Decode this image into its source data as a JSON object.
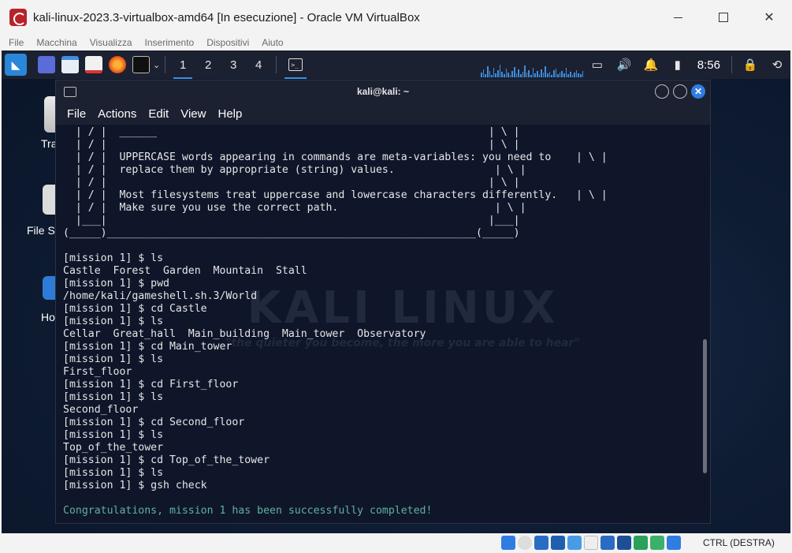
{
  "window": {
    "title": "kali-linux-2023.3-virtualbox-amd64 [In esecuzione] - Oracle VM VirtualBox",
    "minimize": "",
    "maximize": "",
    "close": "✕"
  },
  "vbox_menu": [
    "File",
    "Macchina",
    "Visualizza",
    "Inserimento",
    "Dispositivi",
    "Aiuto"
  ],
  "panel": {
    "workspaces": [
      "1",
      "2",
      "3",
      "4"
    ],
    "clock": "8:56"
  },
  "desktop": {
    "icons": [
      {
        "label": "Tras"
      },
      {
        "label": "File S"
      },
      {
        "label": "Ho"
      }
    ]
  },
  "terminal": {
    "title": "kali@kali: ~",
    "menu": [
      "File",
      "Actions",
      "Edit",
      "View",
      "Help"
    ],
    "watermark": {
      "main": "KALI LINUX",
      "sub": "\"the quieter you become, the more you are able to hear\""
    },
    "lines": [
      "  | / |  ______                                                     | \\ |",
      "  | / |                                                             | \\ |",
      "  | / |  UPPERCASE words appearing in commands are meta-variables: you need to    | \\ |",
      "  | / |  replace them by appropriate (string) values.                | \\ |",
      "  | / |                                                             | \\ |",
      "  | / |  Most filesystems treat uppercase and lowercase characters differently.   | \\ |",
      "  | / |  Make sure you use the correct path.                         | \\ |",
      "  |___|                                                             |___|",
      "(_____)___________________________________________________________(_____)",
      "",
      "[mission 1] $ ls",
      "Castle  Forest  Garden  Mountain  Stall",
      "[mission 1] $ pwd",
      "/home/kali/gameshell.sh.3/World",
      "[mission 1] $ cd Castle",
      "[mission 1] $ ls",
      "Cellar  Great_hall  Main_building  Main_tower  Observatory",
      "[mission 1] $ cd Main_tower",
      "[mission 1] $ ls",
      "First_floor",
      "[mission 1] $ cd First_floor",
      "[mission 1] $ ls",
      "Second_floor",
      "[mission 1] $ cd Second_floor",
      "[mission 1] $ ls",
      "Top_of_the_tower",
      "[mission 1] $ cd Top_of_the_tower",
      "[mission 1] $ ls",
      "[mission 1] $ gsh check",
      ""
    ],
    "success": "Congratulations, mission 1 has been successfully completed!"
  },
  "statusbar": {
    "host_key": "CTRL (DESTRA)"
  }
}
